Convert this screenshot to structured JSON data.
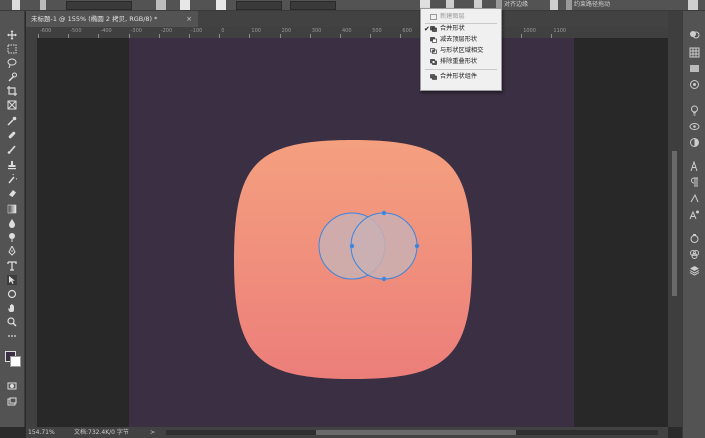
{
  "document_tab": {
    "title": "未标题-1 @ 155% (椭圆 2 拷贝, RGB/8) *",
    "close_glyph": "×"
  },
  "options_bar": {
    "field1_value": "10 像素",
    "align_label": "对齐边缘",
    "constrain_label": "约束路径拖动",
    "path_ops_icon": "combine-shapes-icon"
  },
  "path_operations_menu": {
    "items": [
      {
        "label": "新建图层",
        "checked": false,
        "disabled": true,
        "icon": "new-layer-icon"
      },
      {
        "label": "合并形状",
        "checked": true,
        "disabled": false,
        "icon": "combine-shapes-icon"
      },
      {
        "label": "减去顶层形状",
        "checked": false,
        "disabled": false,
        "icon": "subtract-front-shape-icon"
      },
      {
        "label": "与形状区域相交",
        "checked": false,
        "disabled": false,
        "icon": "intersect-shape-areas-icon"
      },
      {
        "label": "排除重叠形状",
        "checked": false,
        "disabled": false,
        "icon": "exclude-overlapping-shapes-icon"
      },
      {
        "label": "合并形状组件",
        "checked": false,
        "disabled": false,
        "icon": "merge-shape-components-icon"
      }
    ]
  },
  "ruler": {
    "ticks": [
      "-600",
      "-500",
      "-400",
      "-300",
      "-200",
      "-100",
      "0",
      "100",
      "200",
      "300",
      "400",
      "500",
      "600",
      "700",
      "800",
      "900",
      "1000",
      "1100"
    ]
  },
  "status_bar": {
    "zoom": "154.71%",
    "doc_info": "文档:732.4K/0 字节",
    "arrow": ">"
  },
  "colors": {
    "canvas_bg": "#3a2f43",
    "shape_top": "#f4a07f",
    "shape_bottom": "#ec7e7a",
    "path_stroke": "#3a86e0",
    "circle_fill": "#c9b0b3"
  }
}
